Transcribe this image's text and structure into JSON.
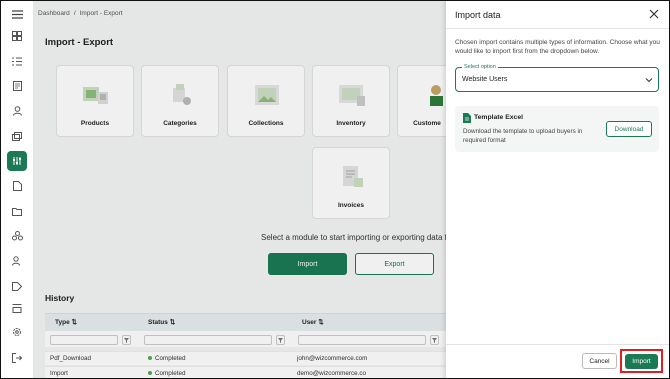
{
  "breadcrumb": {
    "home": "Dashboard",
    "separator": "/",
    "current": "Import - Export"
  },
  "page_title": "Import - Export",
  "modules": [
    {
      "label": "Products",
      "icon": "products-icon"
    },
    {
      "label": "Categories",
      "icon": "categories-icon"
    },
    {
      "label": "Collections",
      "icon": "collections-icon"
    },
    {
      "label": "Inventory",
      "icon": "inventory-icon"
    },
    {
      "label": "Custome",
      "icon": "customers-icon"
    },
    {
      "label": "Invoices",
      "icon": "invoices-icon"
    }
  ],
  "hint": "Select a module to start importing or exporting data for",
  "main_buttons": {
    "import": "Import",
    "export": "Export"
  },
  "history": {
    "title": "History",
    "columns": [
      "Type",
      "Status",
      "User"
    ],
    "rows": [
      {
        "type": "Pdf_Download",
        "status": "Completed",
        "user": "john@wizcommerce.com"
      },
      {
        "type": "Import",
        "status": "Completed",
        "user": "demo@wizcommerce.co"
      }
    ]
  },
  "panel": {
    "title": "Import data",
    "description": "Chosen import contains multiple types of information. Choose what you would like to import first from the dropdown below.",
    "select_label": "Select option",
    "select_value": "Website Users",
    "template_title": "Template Excel",
    "template_desc": "Download the template to upload buyers in required format",
    "download_label": "Download",
    "cancel_label": "Cancel",
    "import_label": "Import"
  },
  "colors": {
    "accent": "#1b7a55",
    "highlight": "#e02020"
  }
}
